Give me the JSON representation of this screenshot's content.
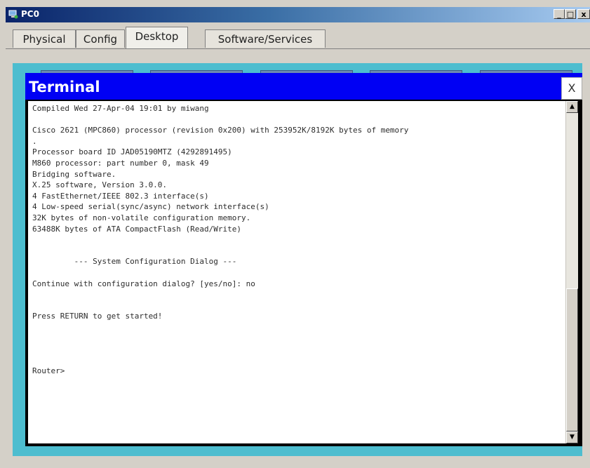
{
  "window": {
    "title": "PC0",
    "minimize_label": "_",
    "maximize_label": "□",
    "close_label": "x"
  },
  "tabs": [
    {
      "label": "Physical",
      "active": false
    },
    {
      "label": "Config",
      "active": false
    },
    {
      "label": "Desktop",
      "active": true
    },
    {
      "label": "Software/Services",
      "active": false
    }
  ],
  "terminal": {
    "title": "Terminal",
    "close_label": "X",
    "output": "Compiled Wed 27-Apr-04 19:01 by miwang\n\nCisco 2621 (MPC860) processor (revision 0x200) with 253952K/8192K bytes of memory\n.\nProcessor board ID JAD05190MTZ (4292891495)\nM860 processor: part number 0, mask 49\nBridging software.\nX.25 software, Version 3.0.0.\n4 FastEthernet/IEEE 802.3 interface(s)\n4 Low-speed serial(sync/async) network interface(s)\n32K bytes of non-volatile configuration memory.\n63488K bytes of ATA CompactFlash (Read/Write)\n\n\n         --- System Configuration Dialog ---\n\nContinue with configuration dialog? [yes/no]: no\n\n\nPress RETURN to get started!\n\n\n\n\nRouter>",
    "scroll_position_fraction": 0.55,
    "scroll_visible_fraction": 0.45
  },
  "icons": {
    "app": "pc-app-icon",
    "scroll_up": "scroll-up-arrow-icon",
    "scroll_down": "scroll-down-arrow-icon"
  },
  "colors": {
    "title_bar_start": "#0a246a",
    "terminal_header": "#0000f4",
    "desktop_background": "#4dbdcf"
  }
}
